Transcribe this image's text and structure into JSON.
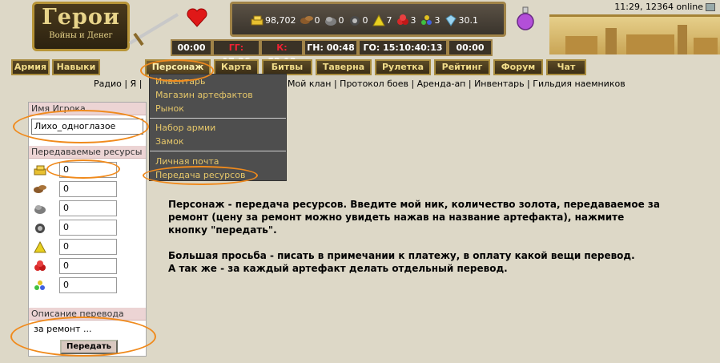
{
  "header": {
    "logo_title": "Герои",
    "logo_subtitle": "Войны и Денег",
    "time_online": "11:29, 12364 online",
    "resources": [
      {
        "icon": "gold-icon",
        "value": "98,702"
      },
      {
        "icon": "wood-icon",
        "value": "0"
      },
      {
        "icon": "ore-icon",
        "value": "0"
      },
      {
        "icon": "mercury-icon",
        "value": "0"
      },
      {
        "icon": "sulfur-icon",
        "value": "7"
      },
      {
        "icon": "crystal-icon",
        "value": "3"
      },
      {
        "icon": "gems-icon",
        "value": "3"
      },
      {
        "icon": "diamond-icon",
        "value": "30.1"
      }
    ],
    "timers": [
      {
        "label": "00:00"
      },
      {
        "prefix": "ГГ:",
        "label": "17:26"
      },
      {
        "prefix": "К:",
        "label": "52:13"
      },
      {
        "label": "ГН: 00:48"
      },
      {
        "label": "ГО: 15:10:40:13"
      },
      {
        "label": "00:00"
      }
    ]
  },
  "nav": {
    "left": [
      "Армия",
      "Навыки"
    ],
    "main": [
      "Персонаж",
      "Карта",
      "Битвы",
      "Таверна",
      "Рулетка",
      "Рейтинг",
      "Форум",
      "Чат"
    ],
    "active": "Персонаж"
  },
  "sublinks": {
    "left": "Радио | Я |",
    "right": "Мой клан | Протокол боев | Аренда-ап | Инвентарь | Гильдия наемников"
  },
  "dropdown": {
    "items": [
      "Инвентарь",
      "Магазин артефактов",
      "Рынок",
      "Набор армии",
      "Замок",
      "Личная почта",
      "Передача ресурсов"
    ]
  },
  "form": {
    "player_header": "Имя Игрока",
    "player_name": "Лихо_одноглазое",
    "resources_header": "Передаваемые ресурсы",
    "resource_values": [
      "0",
      "0",
      "0",
      "0",
      "0",
      "0",
      "0"
    ],
    "resource_icons": [
      "gold-icon",
      "wood-icon",
      "ore-icon",
      "mercury-icon",
      "sulfur-icon",
      "crystal-icon",
      "gems-icon"
    ],
    "description_header": "Описание перевода",
    "description_value": "за ремонт ...",
    "submit_label": "Передать"
  },
  "content": {
    "paragraph1": "Персонаж - передача ресурсов. Введите мой ник, количество золота, передаваемое за ремонт (цену за ремонт можно увидеть нажав на название артефакта), нажмите кнопку \"передать\".",
    "paragraph2": "Большая просьба - писать в примечании к платежу, в оплату какой вещи перевод.",
    "paragraph3": "А так же - за каждый артефакт делать отдельный перевод."
  },
  "colors": {
    "background": "#ddd8c7",
    "nav_gold": "#f1dc8a",
    "dropdown_bg": "#4e4e4e",
    "dropdown_text": "#e6c76a",
    "highlight": "#f08a1c",
    "form_header_bg": "#ecd4d4"
  }
}
